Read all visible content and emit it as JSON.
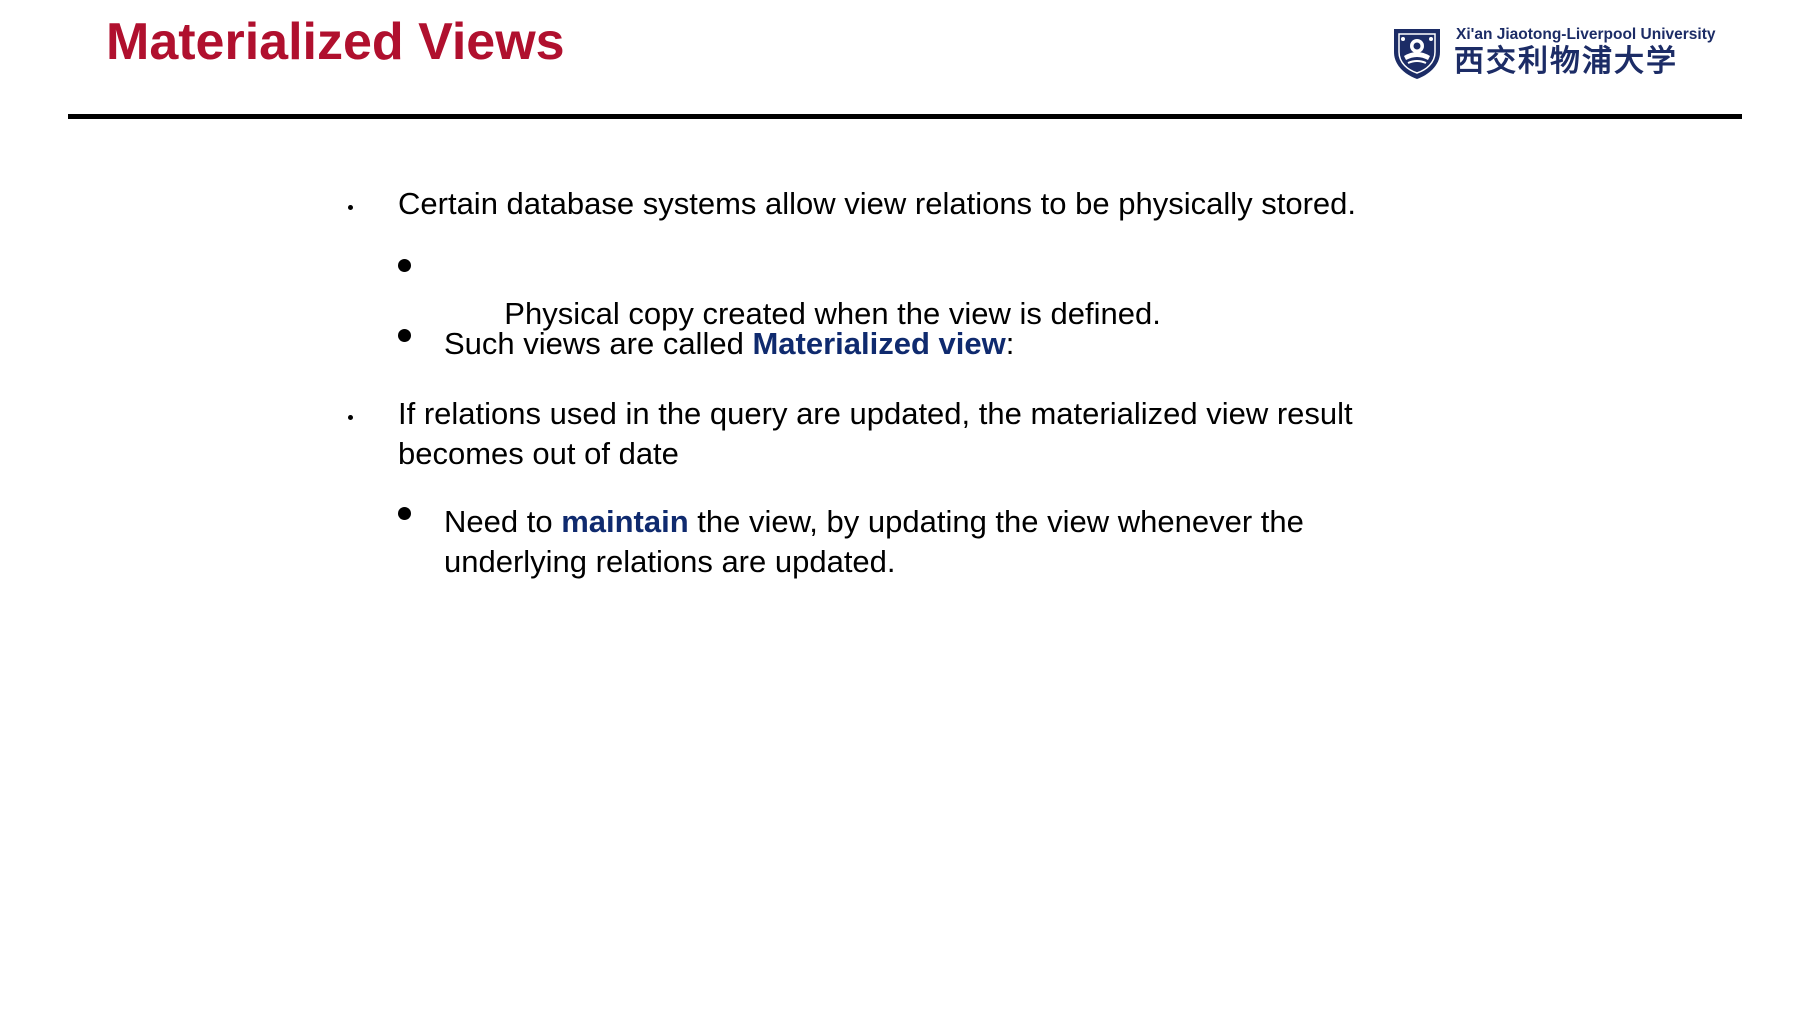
{
  "slide": {
    "title": "Materialized Views",
    "logo": {
      "name_en": "Xi'an Jiaotong-Liverpool University",
      "name_cn": "西交利物浦大学",
      "emblem_icon": "university-shield-icon"
    },
    "colors": {
      "title": "#b0102e",
      "highlight": "#0f2a6e",
      "logo": "#1c2c66"
    },
    "bullets": [
      {
        "text": "Certain database systems allow view relations to be physically stored.",
        "sub": [
          {
            "text": " Physical copy created when the view is defined."
          },
          {
            "before": "Such views are called ",
            "highlight": "Materialized view",
            "after": ":"
          }
        ]
      },
      {
        "text": "If relations used in the query are updated, the materialized view result becomes out of date",
        "sub": [
          {
            "before": "Need to ",
            "highlight": "maintain",
            "after": " the view, by updating the view whenever the underlying relations are updated."
          }
        ]
      }
    ]
  }
}
